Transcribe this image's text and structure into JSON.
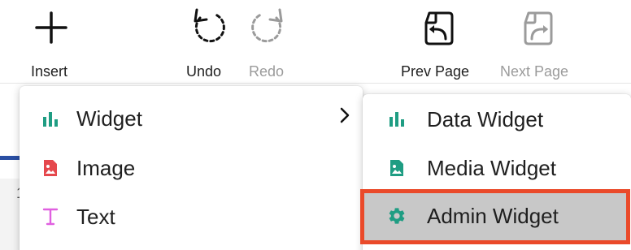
{
  "toolbar": {
    "insert": {
      "label": "Insert"
    },
    "undo": {
      "label": "Undo"
    },
    "redo": {
      "label": "Redo"
    },
    "prev_page": {
      "label": "Prev Page"
    },
    "next_page": {
      "label": "Next Page"
    }
  },
  "background": {
    "fragment": "1"
  },
  "insert_menu": {
    "items": [
      {
        "label": "Widget",
        "icon": "bar-chart-icon",
        "color": "#1f9d83"
      },
      {
        "label": "Image",
        "icon": "image-icon",
        "color": "#e5484d"
      },
      {
        "label": "Text",
        "icon": "text-icon",
        "color": "#e060e0"
      }
    ]
  },
  "widget_submenu": {
    "items": [
      {
        "label": "Data Widget",
        "icon": "bar-chart-icon",
        "color": "#1f9d83"
      },
      {
        "label": "Media Widget",
        "icon": "image-icon",
        "color": "#1f9d83"
      },
      {
        "label": "Admin Widget",
        "icon": "gear-icon",
        "color": "#1f9d83"
      }
    ]
  },
  "colors": {
    "highlight_bg": "#c8c8c8",
    "highlight_border": "#ea4a2a",
    "disabled_text": "#9b9b9b"
  }
}
